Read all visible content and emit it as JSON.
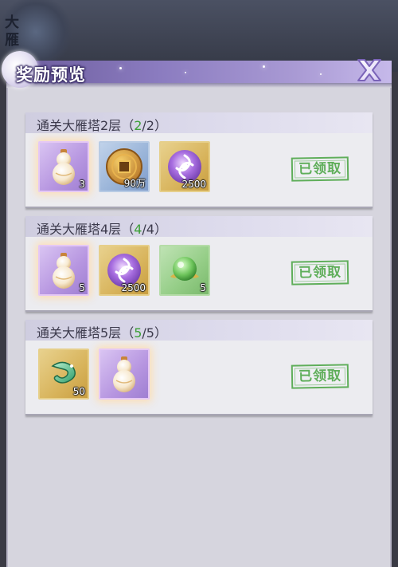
{
  "background": {
    "vertical_text": "大雁"
  },
  "dialog": {
    "title": "奖励预览",
    "close_icon": "close-x-icon"
  },
  "colors": {
    "title_bar": "#8b7cc0",
    "panel_bg": "#d6d5de",
    "card_bg": "#ececf0",
    "progress_green": "#3da037",
    "stamp_green": "#5fae5a"
  },
  "rewards": [
    {
      "label": "通关大雁塔2层",
      "progress_open": "（",
      "progress_current": "2",
      "progress_total": "/2",
      "progress_close": "）",
      "items": [
        {
          "icon": "gourd-icon",
          "frame": "purple",
          "count": "3"
        },
        {
          "icon": "copper-coin-icon",
          "frame": "blue",
          "count": "90万"
        },
        {
          "icon": "purple-swirl-orb-icon",
          "frame": "gold",
          "count": "2500"
        }
      ],
      "status": "已领取"
    },
    {
      "label": "通关大雁塔4层",
      "progress_open": "（",
      "progress_current": "4",
      "progress_total": "/4",
      "progress_close": "）",
      "items": [
        {
          "icon": "gourd-icon",
          "frame": "purple",
          "count": "5"
        },
        {
          "icon": "purple-swirl-orb-icon",
          "frame": "gold",
          "count": "2500"
        },
        {
          "icon": "green-jade-bead-icon",
          "frame": "green",
          "count": "5"
        }
      ],
      "status": "已领取"
    },
    {
      "label": "通关大雁塔5层",
      "progress_open": "（",
      "progress_current": "5",
      "progress_total": "/5",
      "progress_close": "）",
      "items": [
        {
          "icon": "green-jade-dragon-icon",
          "frame": "gold",
          "count": "50"
        },
        {
          "icon": "gourd-icon",
          "frame": "purple",
          "count": ""
        }
      ],
      "status": "已领取"
    }
  ]
}
